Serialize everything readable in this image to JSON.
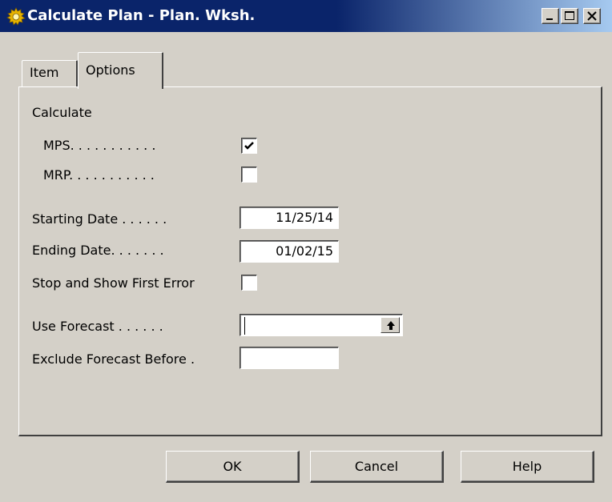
{
  "window": {
    "title": "Calculate Plan - Plan. Wksh.",
    "app_icon": "gear-icon",
    "controls": [
      "minimize-icon",
      "maximize-icon",
      "close-icon"
    ]
  },
  "tabs": [
    {
      "label": "Item",
      "active": false
    },
    {
      "label": "Options",
      "active": true
    }
  ],
  "options": {
    "calculate_heading": "Calculate",
    "mps_label": "MPS. . . . . . . . . . .",
    "mps_checked": true,
    "mrp_label": "MRP. . . . . . . . . . .",
    "mrp_checked": false,
    "starting_date_label": "Starting Date . . . . . .",
    "starting_date_value": "11/25/14",
    "ending_date_label": "Ending Date. . . . . . .",
    "ending_date_value": "01/02/15",
    "stop_error_label": "Stop and Show First Error",
    "stop_error_checked": false,
    "use_forecast_label": "Use Forecast . . . . . .",
    "use_forecast_value": "",
    "exclude_forecast_label": "Exclude Forecast Before .",
    "exclude_forecast_value": ""
  },
  "buttons": {
    "ok": "OK",
    "cancel": "Cancel",
    "help": "Help"
  }
}
